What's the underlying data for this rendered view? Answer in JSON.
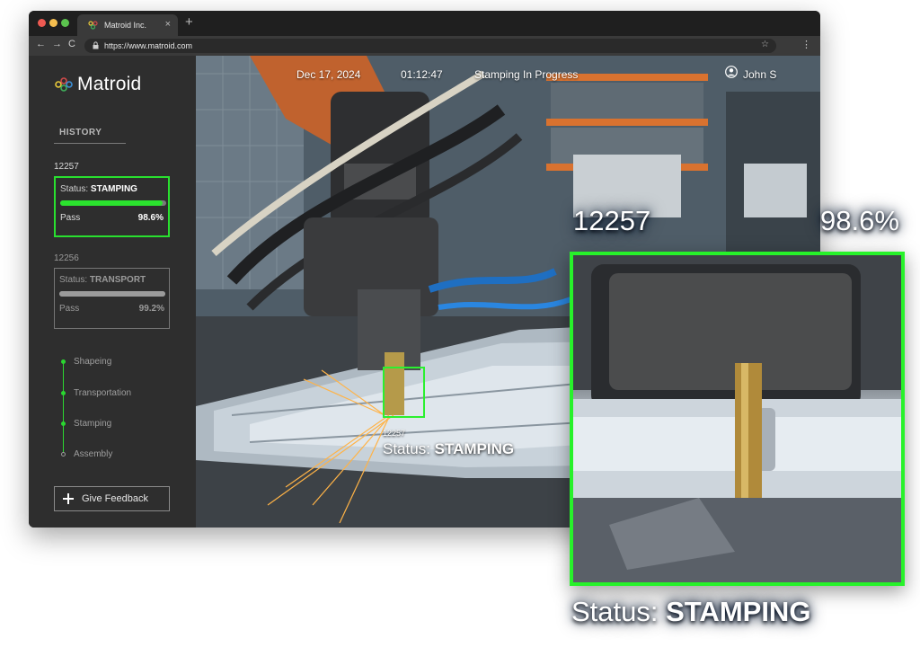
{
  "browser": {
    "tab_title": "Matroid Inc.",
    "tab_close": "×",
    "new_tab": "+",
    "url": "https://www.matroid.com",
    "back": "←",
    "forward": "→",
    "reload": "C",
    "star": "☆",
    "menu": "⋮"
  },
  "sidebar": {
    "logo": "Matroid",
    "history_title": "HISTORY",
    "jobs": [
      {
        "id": "12257",
        "status_label": "Status:",
        "status": "STAMPING",
        "progress": 0.97,
        "pass_label": "Pass",
        "pass": "98.6%"
      },
      {
        "id": "12256",
        "status_label": "Status:",
        "status": "TRANSPORT",
        "progress": 1.0,
        "pass_label": "Pass",
        "pass": "99.2%"
      }
    ],
    "stages": [
      {
        "label": "Shapeing",
        "state": "done"
      },
      {
        "label": "Transportation",
        "state": "done"
      },
      {
        "label": "Stamping",
        "state": "done"
      },
      {
        "label": "Assembly",
        "state": "todo"
      }
    ],
    "feedback_label": "Give Feedback"
  },
  "header": {
    "date": "Dec 17, 2024",
    "time": "01:12:47",
    "status": "Stamping In Progress",
    "user": "John S"
  },
  "detection": {
    "id": "12257",
    "status_label": "Status:",
    "status": "STAMPING"
  },
  "zoom": {
    "id": "12257",
    "pass": "98.6%",
    "status_label": "Status:",
    "status": "STAMPING"
  },
  "colors": {
    "accent_green": "#29e02f",
    "sidebar_bg": "#2e2e2e"
  },
  "icons": [
    "matroid-logo-icon",
    "lock-icon",
    "star-icon",
    "user-icon",
    "plus-icon"
  ]
}
